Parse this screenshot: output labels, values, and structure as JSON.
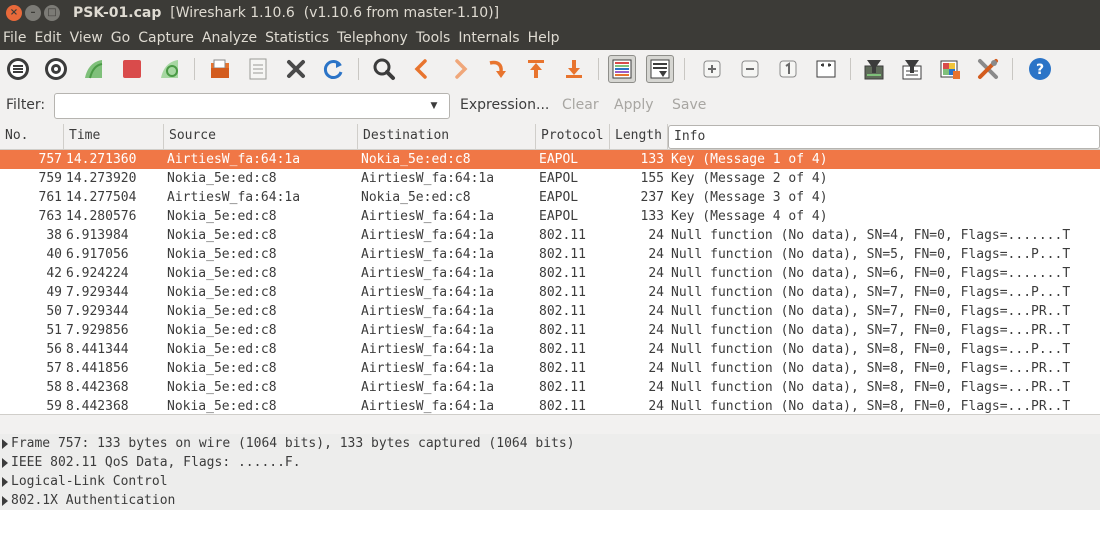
{
  "window": {
    "file_name": "PSK-01.cap",
    "app_title": "[Wireshark 1.10.6  (v1.10.6 from master-1.10)]",
    "buttons": [
      "close",
      "minimize",
      "maximize"
    ]
  },
  "menu": {
    "items": [
      "File",
      "Edit",
      "View",
      "Go",
      "Capture",
      "Analyze",
      "Statistics",
      "Telephony",
      "Tools",
      "Internals",
      "Help"
    ]
  },
  "toolbar": {
    "icons": [
      "interfaces-icon",
      "options-icon",
      "start-capture-icon",
      "stop-capture-icon",
      "restart-capture-icon",
      "open-file-icon",
      "save-file-icon",
      "close-file-icon",
      "reload-icon",
      "find-packet-icon",
      "go-back-icon",
      "go-forward-icon",
      "go-to-packet-icon",
      "go-first-icon",
      "go-last-icon",
      "colorize-icon",
      "auto-scroll-icon",
      "zoom-in-icon",
      "zoom-out-icon",
      "normal-size-icon",
      "resize-columns-icon",
      "capture-filters-icon",
      "display-filters-icon",
      "coloring-rules-icon",
      "preferences-icon",
      "help-icon"
    ],
    "colors": {
      "accent_blue": "#2b74c7",
      "green": "#7fc07a",
      "red": "#d94b4b",
      "orange": "#e8742e"
    }
  },
  "filter": {
    "label": "Filter:",
    "value": "",
    "expression_label": "Expression...",
    "clear_label": "Clear",
    "apply_label": "Apply",
    "save_label": "Save"
  },
  "packet_list": {
    "columns": [
      "No.",
      "Time",
      "Source",
      "Destination",
      "Protocol",
      "Length",
      "Info"
    ],
    "selected_color": "#f07746",
    "rows": [
      {
        "no": "757",
        "time": "14.271360",
        "source": "AirtiesW_fa:64:1a",
        "destination": "Nokia_5e:ed:c8",
        "protocol": "EAPOL",
        "length": "133",
        "info": "Key (Message 1 of 4)",
        "selected": true
      },
      {
        "no": "759",
        "time": "14.273920",
        "source": "Nokia_5e:ed:c8",
        "destination": "AirtiesW_fa:64:1a",
        "protocol": "EAPOL",
        "length": "155",
        "info": "Key (Message 2 of 4)"
      },
      {
        "no": "761",
        "time": "14.277504",
        "source": "AirtiesW_fa:64:1a",
        "destination": "Nokia_5e:ed:c8",
        "protocol": "EAPOL",
        "length": "237",
        "info": "Key (Message 3 of 4)"
      },
      {
        "no": "763",
        "time": "14.280576",
        "source": "Nokia_5e:ed:c8",
        "destination": "AirtiesW_fa:64:1a",
        "protocol": "EAPOL",
        "length": "133",
        "info": "Key (Message 4 of 4)"
      },
      {
        "no": "38",
        "time": "6.913984",
        "source": "Nokia_5e:ed:c8",
        "destination": "AirtiesW_fa:64:1a",
        "protocol": "802.11",
        "length": "24",
        "info": "Null function (No data), SN=4, FN=0, Flags=.......T"
      },
      {
        "no": "40",
        "time": "6.917056",
        "source": "Nokia_5e:ed:c8",
        "destination": "AirtiesW_fa:64:1a",
        "protocol": "802.11",
        "length": "24",
        "info": "Null function (No data), SN=5, FN=0, Flags=...P...T"
      },
      {
        "no": "42",
        "time": "6.924224",
        "source": "Nokia_5e:ed:c8",
        "destination": "AirtiesW_fa:64:1a",
        "protocol": "802.11",
        "length": "24",
        "info": "Null function (No data), SN=6, FN=0, Flags=.......T"
      },
      {
        "no": "49",
        "time": "7.929344",
        "source": "Nokia_5e:ed:c8",
        "destination": "AirtiesW_fa:64:1a",
        "protocol": "802.11",
        "length": "24",
        "info": "Null function (No data), SN=7, FN=0, Flags=...P...T"
      },
      {
        "no": "50",
        "time": "7.929344",
        "source": "Nokia_5e:ed:c8",
        "destination": "AirtiesW_fa:64:1a",
        "protocol": "802.11",
        "length": "24",
        "info": "Null function (No data), SN=7, FN=0, Flags=...PR..T"
      },
      {
        "no": "51",
        "time": "7.929856",
        "source": "Nokia_5e:ed:c8",
        "destination": "AirtiesW_fa:64:1a",
        "protocol": "802.11",
        "length": "24",
        "info": "Null function (No data), SN=7, FN=0, Flags=...PR..T"
      },
      {
        "no": "56",
        "time": "8.441344",
        "source": "Nokia_5e:ed:c8",
        "destination": "AirtiesW_fa:64:1a",
        "protocol": "802.11",
        "length": "24",
        "info": "Null function (No data), SN=8, FN=0, Flags=...P...T"
      },
      {
        "no": "57",
        "time": "8.441856",
        "source": "Nokia_5e:ed:c8",
        "destination": "AirtiesW_fa:64:1a",
        "protocol": "802.11",
        "length": "24",
        "info": "Null function (No data), SN=8, FN=0, Flags=...PR..T"
      },
      {
        "no": "58",
        "time": "8.442368",
        "source": "Nokia_5e:ed:c8",
        "destination": "AirtiesW_fa:64:1a",
        "protocol": "802.11",
        "length": "24",
        "info": "Null function (No data), SN=8, FN=0, Flags=...PR..T"
      },
      {
        "no": "59",
        "time": "8.442368",
        "source": "Nokia_5e:ed:c8",
        "destination": "AirtiesW_fa:64:1a",
        "protocol": "802.11",
        "length": "24",
        "info": "Null function (No data), SN=8, FN=0, Flags=...PR..T"
      }
    ]
  },
  "details": {
    "lines": [
      "Frame 757: 133 bytes on wire (1064 bits), 133 bytes captured (1064 bits)",
      "IEEE 802.11 QoS Data, Flags: ......F.",
      "Logical-Link Control",
      "802.1X Authentication"
    ]
  }
}
